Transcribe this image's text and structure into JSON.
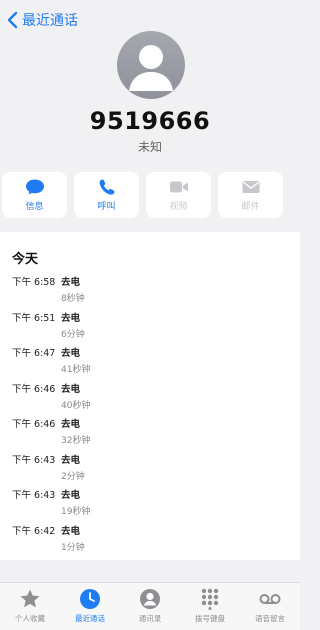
{
  "nav": {
    "back_label": "最近通话"
  },
  "contact": {
    "number": "9519666",
    "label": "未知"
  },
  "actions": [
    {
      "label": "信息",
      "icon": "message-icon",
      "state": "active"
    },
    {
      "label": "呼叫",
      "icon": "phone-icon",
      "state": "active"
    },
    {
      "label": "视频",
      "icon": "video-icon",
      "state": "disabled"
    },
    {
      "label": "邮件",
      "icon": "mail-icon",
      "state": "disabled"
    }
  ],
  "history": {
    "title": "今天",
    "calls": [
      {
        "time": "下午 6:58",
        "type": "去电",
        "duration": "8秒钟"
      },
      {
        "time": "下午 6:51",
        "type": "去电",
        "duration": "6分钟"
      },
      {
        "time": "下午 6:47",
        "type": "去电",
        "duration": "41秒钟"
      },
      {
        "time": "下午 6:46",
        "type": "去电",
        "duration": "40秒钟"
      },
      {
        "time": "下午 6:46",
        "type": "去电",
        "duration": "32秒钟"
      },
      {
        "time": "下午 6:43",
        "type": "去电",
        "duration": "2分钟"
      },
      {
        "time": "下午 6:43",
        "type": "去电",
        "duration": "19秒钟"
      },
      {
        "time": "下午 6:42",
        "type": "去电",
        "duration": "1分钟"
      }
    ]
  },
  "tabs": [
    {
      "label": "个人收藏",
      "icon": "star-icon",
      "active": false
    },
    {
      "label": "最近通话",
      "icon": "clock-icon",
      "active": true
    },
    {
      "label": "通讯录",
      "icon": "contacts-icon",
      "active": false
    },
    {
      "label": "拨号键盘",
      "icon": "keypad-icon",
      "active": false
    },
    {
      "label": "语音留言",
      "icon": "voicemail-icon",
      "active": false
    }
  ],
  "colors": {
    "accent": "#1f7cf2",
    "inactive": "#8e8e93",
    "disabled": "#c8c8cc"
  }
}
